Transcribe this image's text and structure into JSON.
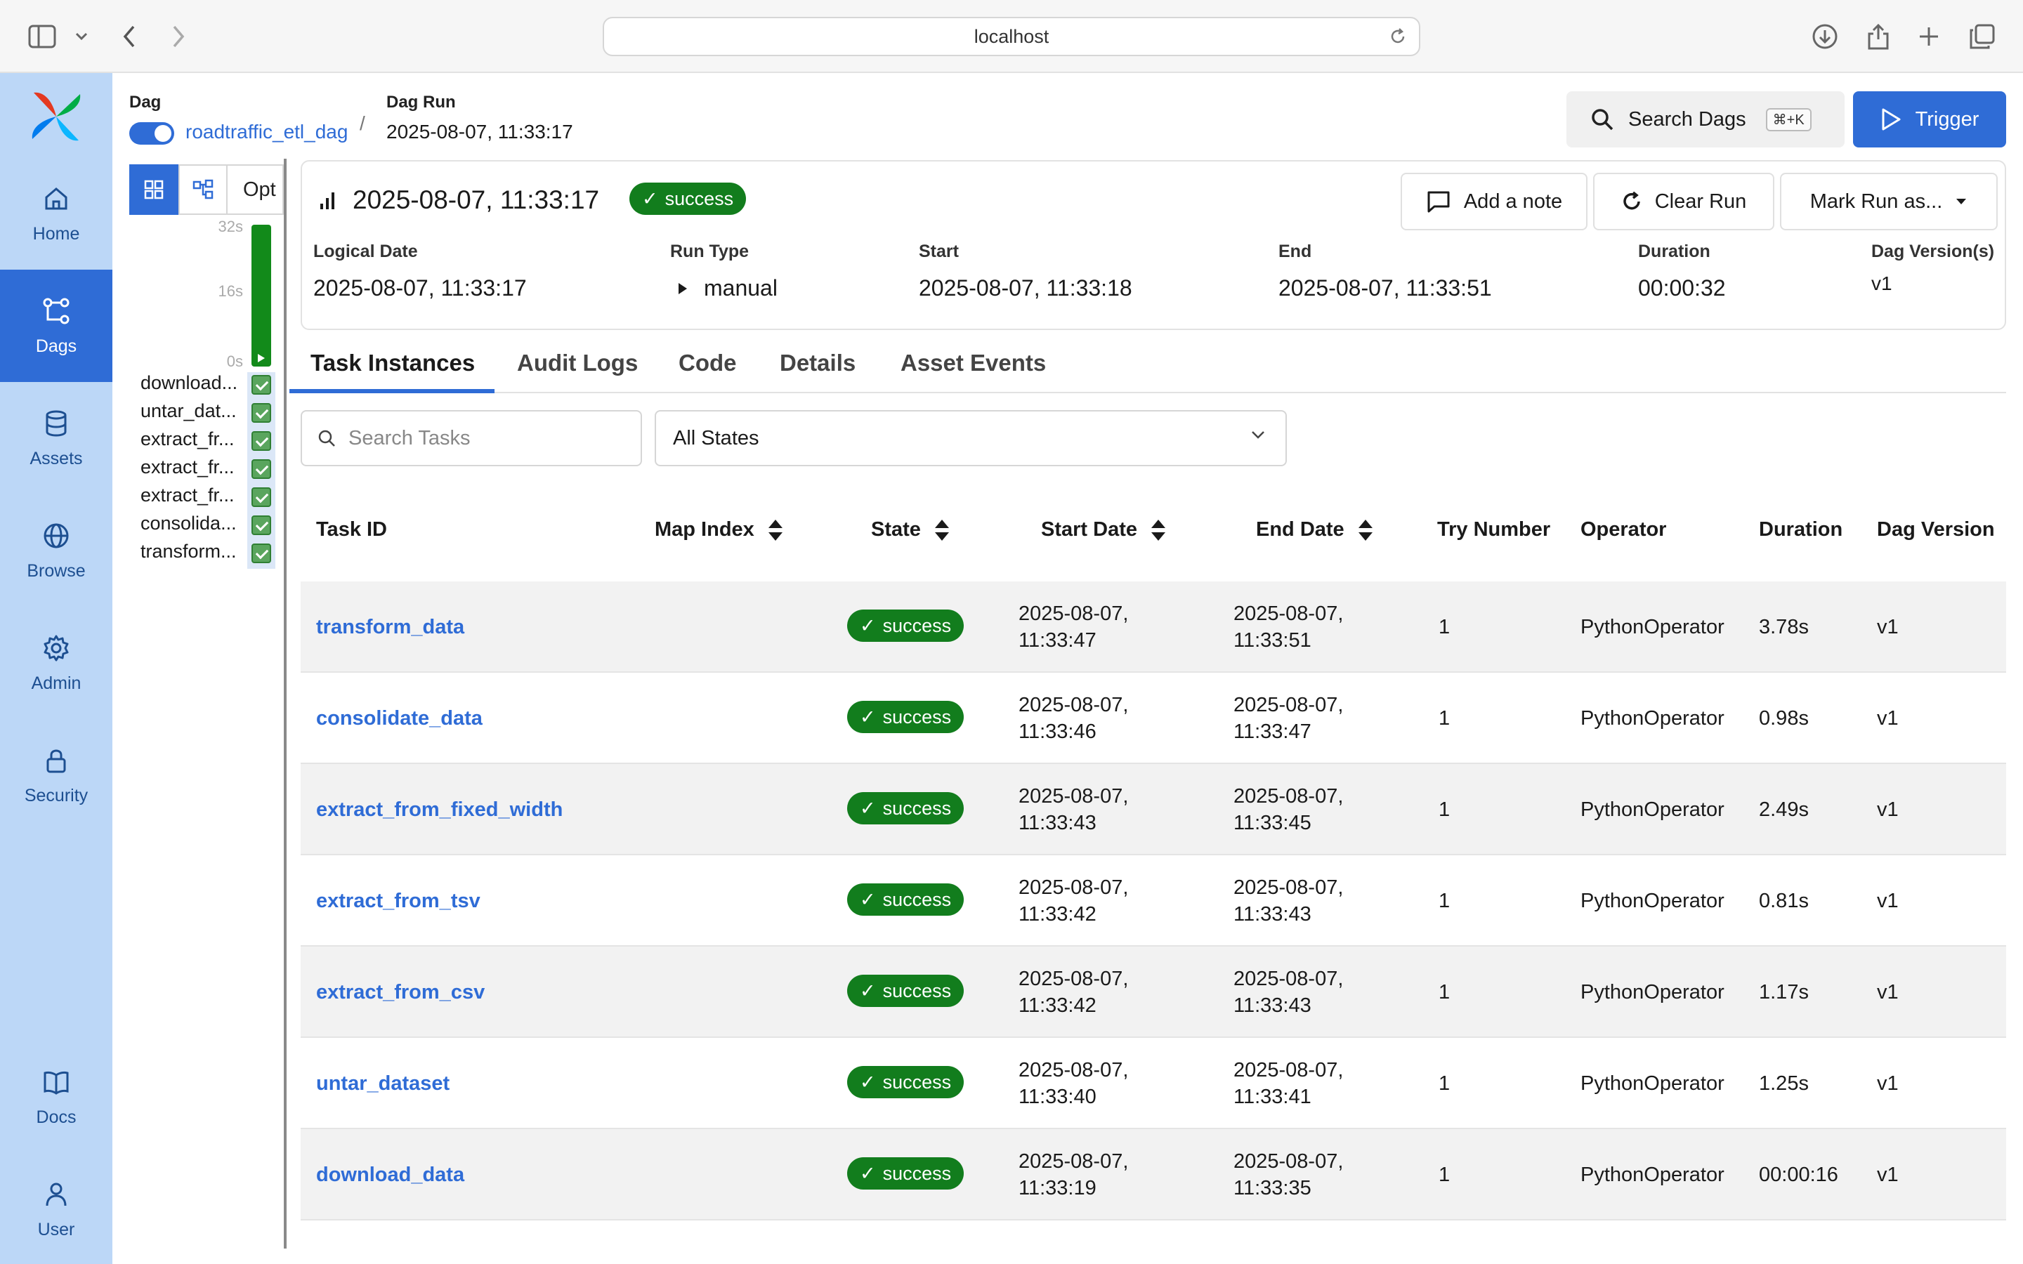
{
  "browser": {
    "url": "localhost"
  },
  "nav": {
    "items": [
      {
        "label": "Home"
      },
      {
        "label": "Dags"
      },
      {
        "label": "Assets"
      },
      {
        "label": "Browse"
      },
      {
        "label": "Admin"
      },
      {
        "label": "Security"
      },
      {
        "label": "Docs"
      },
      {
        "label": "User"
      }
    ]
  },
  "header": {
    "dag_label": "Dag",
    "dag_name": "roadtraffic_etl_dag",
    "dag_run_label": "Dag Run",
    "dag_run_value": "2025-08-07, 11:33:17",
    "search_label": "Search Dags",
    "search_shortcut": "⌘+K",
    "trigger_label": "Trigger"
  },
  "grid": {
    "options_label": "Opt",
    "axis": [
      "32s",
      "16s",
      "0s"
    ],
    "tasks": [
      "download...",
      "untar_dat...",
      "extract_fr...",
      "extract_fr...",
      "extract_fr...",
      "consolida...",
      "transform..."
    ]
  },
  "run": {
    "title": "2025-08-07, 11:33:17",
    "status": "success",
    "buttons": {
      "note": "Add a note",
      "clear": "Clear Run",
      "mark": "Mark Run as..."
    },
    "meta": [
      {
        "label": "Logical Date",
        "value": "2025-08-07, 11:33:17"
      },
      {
        "label": "Run Type",
        "value": "manual"
      },
      {
        "label": "Start",
        "value": "2025-08-07, 11:33:18"
      },
      {
        "label": "End",
        "value": "2025-08-07, 11:33:51"
      },
      {
        "label": "Duration",
        "value": "00:00:32"
      },
      {
        "label": "Dag Version(s)",
        "value": "v1"
      }
    ]
  },
  "tabs": [
    "Task Instances",
    "Audit Logs",
    "Code",
    "Details",
    "Asset Events"
  ],
  "filters": {
    "search_placeholder": "Search Tasks",
    "state_value": "All States"
  },
  "table": {
    "columns": [
      "Task ID",
      "Map Index",
      "State",
      "Start Date",
      "End Date",
      "Try Number",
      "Operator",
      "Duration",
      "Dag Version"
    ],
    "rows": [
      {
        "task": "transform_data",
        "state": "success",
        "start": "2025-08-07, 11:33:47",
        "end": "2025-08-07, 11:33:51",
        "try": "1",
        "op": "PythonOperator",
        "dur": "3.78s",
        "ver": "v1"
      },
      {
        "task": "consolidate_data",
        "state": "success",
        "start": "2025-08-07, 11:33:46",
        "end": "2025-08-07, 11:33:47",
        "try": "1",
        "op": "PythonOperator",
        "dur": "0.98s",
        "ver": "v1"
      },
      {
        "task": "extract_from_fixed_width",
        "state": "success",
        "start": "2025-08-07, 11:33:43",
        "end": "2025-08-07, 11:33:45",
        "try": "1",
        "op": "PythonOperator",
        "dur": "2.49s",
        "ver": "v1"
      },
      {
        "task": "extract_from_tsv",
        "state": "success",
        "start": "2025-08-07, 11:33:42",
        "end": "2025-08-07, 11:33:43",
        "try": "1",
        "op": "PythonOperator",
        "dur": "0.81s",
        "ver": "v1"
      },
      {
        "task": "extract_from_csv",
        "state": "success",
        "start": "2025-08-07, 11:33:42",
        "end": "2025-08-07, 11:33:43",
        "try": "1",
        "op": "PythonOperator",
        "dur": "1.17s",
        "ver": "v1"
      },
      {
        "task": "untar_dataset",
        "state": "success",
        "start": "2025-08-07, 11:33:40",
        "end": "2025-08-07, 11:33:41",
        "try": "1",
        "op": "PythonOperator",
        "dur": "1.25s",
        "ver": "v1"
      },
      {
        "task": "download_data",
        "state": "success",
        "start": "2025-08-07, 11:33:19",
        "end": "2025-08-07, 11:33:35",
        "try": "1",
        "op": "PythonOperator",
        "dur": "00:00:16",
        "ver": "v1"
      }
    ]
  }
}
